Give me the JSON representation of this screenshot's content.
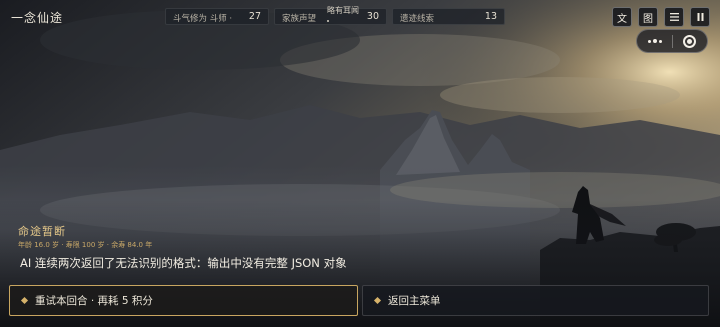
{
  "app": {
    "title": "一念仙途"
  },
  "stats": [
    {
      "label": "斗气修为",
      "rank": "斗师 ·",
      "value": "27"
    },
    {
      "label": "家族声望",
      "tag": "略有耳闻",
      "value": "30"
    },
    {
      "label": "遗迹线索",
      "value": "13"
    }
  ],
  "toolbar": {
    "text_label": "文",
    "image_label": "图",
    "menu_icon": "hamburger-icon",
    "pause_icon": "pause-icon"
  },
  "capsule": {
    "more_icon": "more-dots-icon",
    "close_icon": "target-ring-icon"
  },
  "verdict": {
    "title": "命途暂断",
    "meta": "年龄 16.0 岁 · 寿限 100 岁 · 余寿 84.0 年",
    "message": "AI 连续两次返回了无法识别的格式：输出中没有完整 JSON 对象"
  },
  "choices": [
    {
      "label": "重试本回合 · 再耗 5 积分"
    },
    {
      "label": "返回主菜单"
    }
  ],
  "colors": {
    "accent_gold": "#d6b26a",
    "panel_dark": "#1a1d23",
    "sky_glow": "#f0d9a3"
  }
}
